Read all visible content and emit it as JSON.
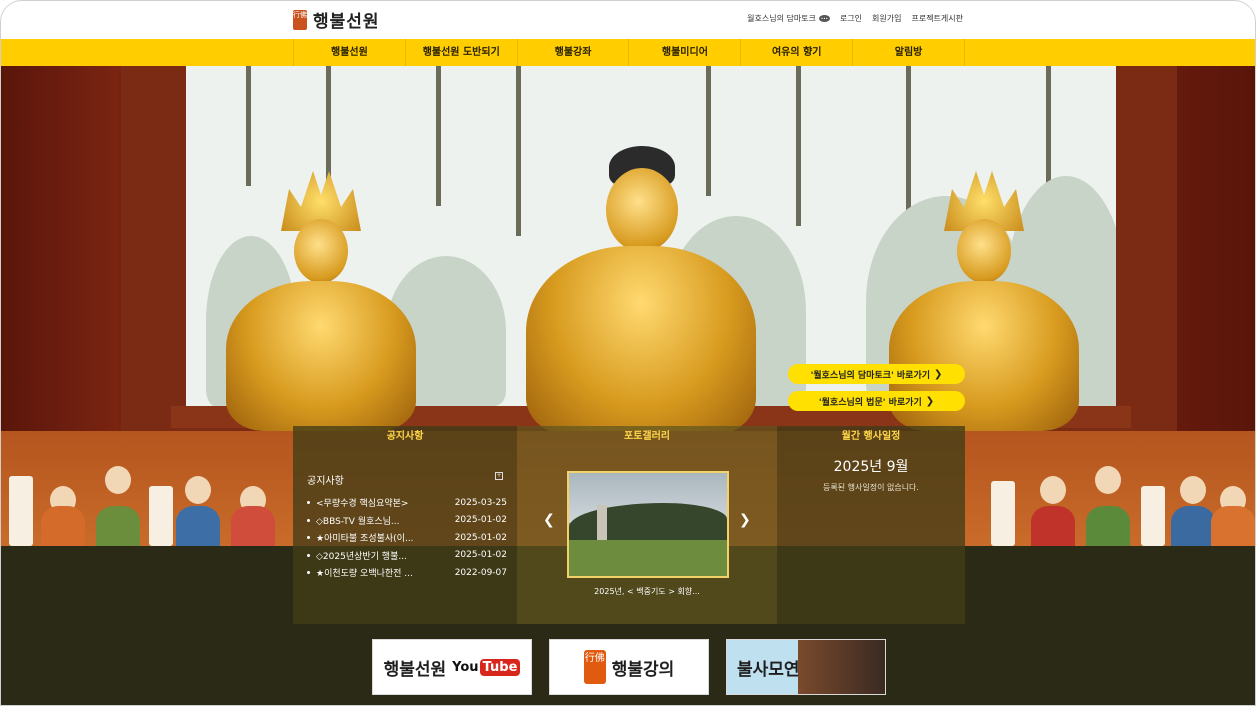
{
  "brand": {
    "logo_mark": "行佛",
    "name": "행불선원"
  },
  "top_links": {
    "dharma_talk": "월호스님의 담마토크",
    "login": "로그인",
    "signup": "회원가입",
    "project_board": "프로젝트게시판"
  },
  "nav": {
    "items": [
      "행불선원",
      "행불선원 도반되기",
      "행불강좌",
      "행불미디어",
      "여유의 향기",
      "알림방"
    ]
  },
  "hero": {
    "btn1": {
      "label": "'월호스님의 담마토크' 바로가기",
      "icon": "chevron-right-icon"
    },
    "btn2": {
      "label": "'월호스님의 법문' 바로가기",
      "icon": "chevron-right-icon"
    }
  },
  "panel": {
    "notice": {
      "heading": "공지사항",
      "title": "공지사항",
      "items": [
        {
          "title": "<무량수경 핵심요약본>",
          "date": "2025-03-25"
        },
        {
          "title": "◇BBS-TV 월호스님...",
          "date": "2025-01-02"
        },
        {
          "title": "★아미타불 조성불사(이...",
          "date": "2025-01-02"
        },
        {
          "title": "◇2025년상반기 행불...",
          "date": "2025-01-02"
        },
        {
          "title": "★이천도량 오백나한전 ...",
          "date": "2022-09-07"
        }
      ]
    },
    "gallery": {
      "heading": "포토갤러리",
      "caption": "2025년, < 백중기도 > 회향..."
    },
    "events": {
      "heading": "월간 행사일정",
      "month": "2025년 9월",
      "empty_text": "등록된 행사일정이 없습니다."
    }
  },
  "banners": {
    "youtube": {
      "label": "행불선원",
      "yt_you": "You",
      "yt_tube": "Tube"
    },
    "lecture": {
      "mark": "行佛",
      "label": "행불강의"
    },
    "restoration": {
      "label": "불사모연"
    }
  },
  "colors": {
    "nav_yellow": "#ffcd00",
    "accent_gold": "#ffd84a",
    "button_yellow": "#ffe000",
    "dark_bg": "#2b2a16"
  }
}
